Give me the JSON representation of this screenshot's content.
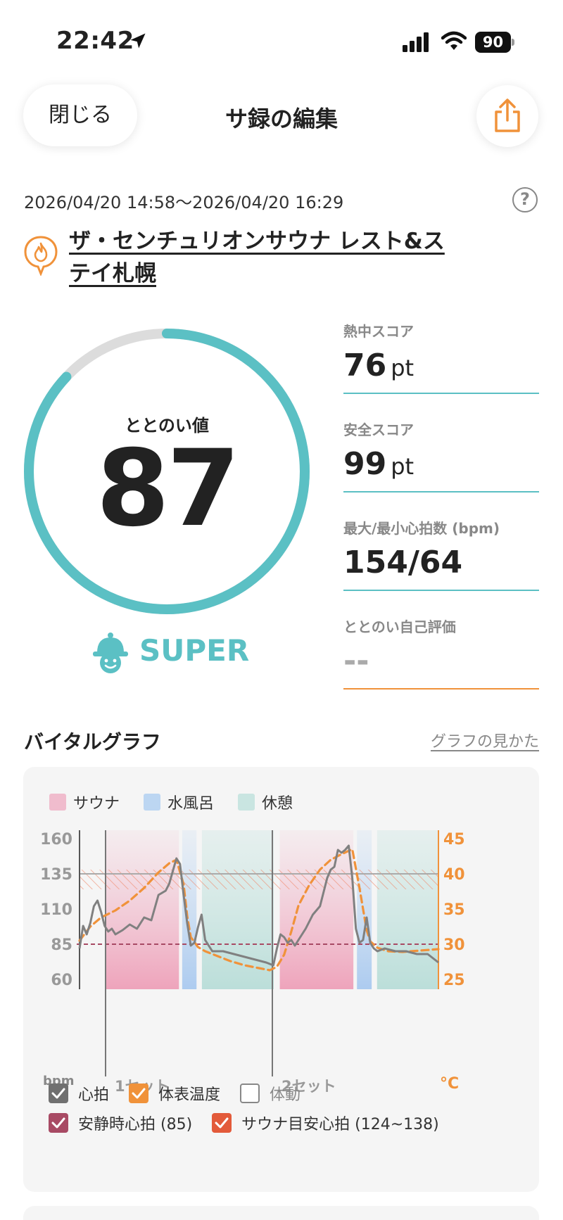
{
  "status_bar": {
    "time": "22:42",
    "battery": "90"
  },
  "header": {
    "close_label": "閉じる",
    "title": "サ録の編集"
  },
  "session": {
    "date_range": "2026/04/20 14:58～2026/04/20 16:29",
    "facility_name": "ザ・センチュリオンサウナ レスト&ステイ札幌"
  },
  "totonoi": {
    "label": "ととのい値",
    "value": "87",
    "level": "SUPER",
    "ring_fill_fraction": 0.87
  },
  "scores": [
    {
      "label": "熱中スコア",
      "value": "76",
      "unit": "pt"
    },
    {
      "label": "安全スコア",
      "value": "99",
      "unit": "pt"
    },
    {
      "label": "最大/最小心拍数 (bpm)",
      "value": "154/64",
      "unit": ""
    },
    {
      "label": "ととのい自己評価",
      "value": "--",
      "unit": ""
    }
  ],
  "vital": {
    "section_title": "バイタルグラフ",
    "guide_link": "グラフの見かた",
    "legend": [
      {
        "label": "サウナ",
        "color": "#f0bccd"
      },
      {
        "label": "水風呂",
        "color": "#bcd6f2"
      },
      {
        "label": "休憩",
        "color": "#c9e5e1"
      }
    ],
    "toggles": {
      "heart_rate": "心拍",
      "skin_temp": "体表温度",
      "body_motion": "体動",
      "resting_hr": "安静時心拍 (85)",
      "sauna_target_hr": "サウナ目安心拍 (124~138)"
    }
  },
  "chart_data": {
    "type": "line",
    "xlabel": "",
    "ylabel": "bpm",
    "y2label": "°C",
    "ylim": [
      60,
      160
    ],
    "y2lim": [
      25,
      45
    ],
    "y_ticks": [
      "160",
      "135",
      "110",
      "85",
      "60"
    ],
    "y2_ticks": [
      "45",
      "40",
      "35",
      "30",
      "25"
    ],
    "set_labels": [
      "1セット",
      "2セット"
    ],
    "phases": [
      {
        "type": "sauna",
        "start": 0.073,
        "end": 0.277
      },
      {
        "type": "cold",
        "start": 0.286,
        "end": 0.326
      },
      {
        "type": "rest",
        "start": 0.341,
        "end": 0.541
      },
      {
        "type": "sauna",
        "start": 0.558,
        "end": 0.763
      },
      {
        "type": "cold",
        "start": 0.773,
        "end": 0.814
      },
      {
        "type": "rest",
        "start": 0.829,
        "end": 1.0
      }
    ],
    "resting_hr": 85,
    "target_hr_band": [
      124,
      138
    ],
    "series": [
      {
        "name": "心拍",
        "color": "#808080",
        "x": [
          0.0,
          0.01,
          0.02,
          0.03,
          0.04,
          0.05,
          0.06,
          0.07,
          0.08,
          0.09,
          0.1,
          0.12,
          0.14,
          0.16,
          0.18,
          0.2,
          0.22,
          0.24,
          0.25,
          0.26,
          0.27,
          0.28,
          0.29,
          0.3,
          0.31,
          0.32,
          0.33,
          0.34,
          0.35,
          0.37,
          0.4,
          0.43,
          0.46,
          0.49,
          0.52,
          0.54,
          0.55,
          0.56,
          0.57,
          0.58,
          0.59,
          0.6,
          0.61,
          0.63,
          0.65,
          0.67,
          0.69,
          0.7,
          0.71,
          0.72,
          0.73,
          0.74,
          0.75,
          0.76,
          0.77,
          0.78,
          0.79,
          0.8,
          0.81,
          0.82,
          0.83,
          0.85,
          0.88,
          0.91,
          0.94,
          0.97,
          1.0
        ],
        "values": [
          82,
          98,
          92,
          100,
          112,
          116,
          108,
          98,
          94,
          96,
          92,
          95,
          99,
          96,
          104,
          102,
          120,
          123,
          128,
          137,
          146,
          142,
          120,
          100,
          84,
          86,
          97,
          106,
          88,
          80,
          80,
          78,
          76,
          74,
          72,
          70,
          82,
          92,
          90,
          86,
          88,
          84,
          88,
          96,
          106,
          112,
          132,
          138,
          140,
          152,
          150,
          152,
          155,
          132,
          96,
          86,
          88,
          104,
          86,
          82,
          80,
          82,
          80,
          80,
          78,
          78,
          72
        ]
      },
      {
        "name": "体表温度",
        "color": "#f0923a",
        "x": [
          0.0,
          0.03,
          0.06,
          0.1,
          0.14,
          0.18,
          0.22,
          0.25,
          0.27,
          0.29,
          0.3,
          0.31,
          0.33,
          0.35,
          0.38,
          0.42,
          0.46,
          0.5,
          0.53,
          0.55,
          0.57,
          0.59,
          0.61,
          0.64,
          0.67,
          0.7,
          0.73,
          0.76,
          0.78,
          0.8,
          0.81,
          0.83,
          0.86,
          0.9,
          0.95,
          1.0
        ],
        "values": [
          30.5,
          32.5,
          33.8,
          34.8,
          36.2,
          38.0,
          40.2,
          41.5,
          42.0,
          38.5,
          34.0,
          31.0,
          29.6,
          29.0,
          28.4,
          27.6,
          27.0,
          26.6,
          26.3,
          26.8,
          28.5,
          31.8,
          35.5,
          38.4,
          40.6,
          42.0,
          42.8,
          43.5,
          38.0,
          32.0,
          30.4,
          29.5,
          29.0,
          28.9,
          29.1,
          29.3
        ]
      }
    ]
  }
}
